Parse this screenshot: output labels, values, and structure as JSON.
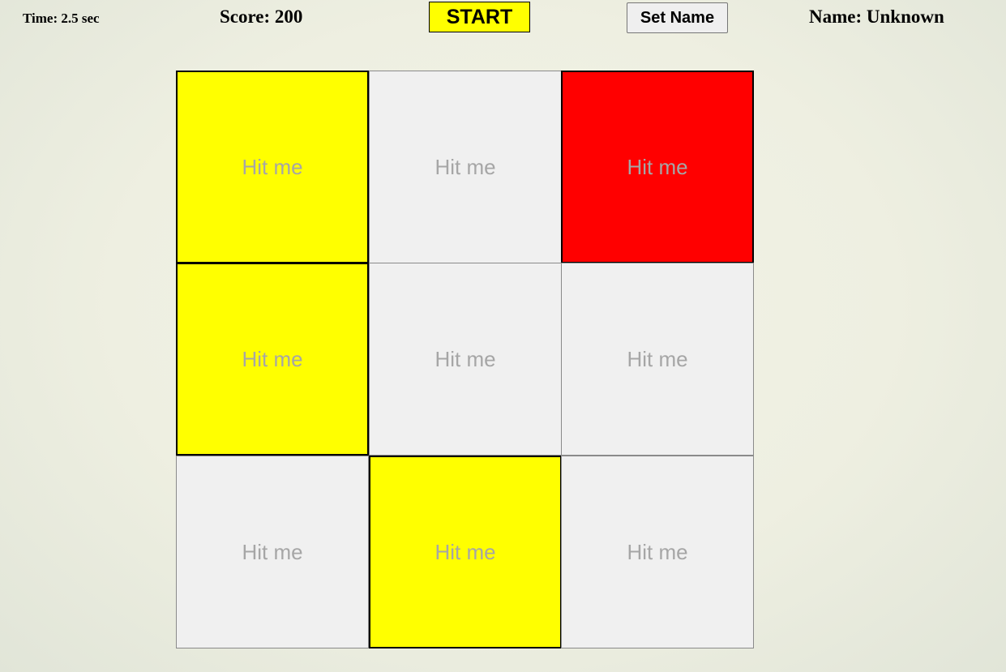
{
  "hud": {
    "time_label": "Time: 2.5 sec",
    "score_label": "Score: 200",
    "start_label": "START",
    "set_name_label": "Set Name",
    "name_label": "Name: Unknown"
  },
  "colors": {
    "inactive": "#f0f0f0",
    "yellow": "#ffff00",
    "red": "#ff0000",
    "start_button": "#ffff00"
  },
  "board": {
    "rows": 3,
    "cols": 3,
    "cells": [
      {
        "label": "Hit me",
        "state": "yellow"
      },
      {
        "label": "Hit me",
        "state": "inactive"
      },
      {
        "label": "Hit me",
        "state": "red"
      },
      {
        "label": "Hit me",
        "state": "yellow"
      },
      {
        "label": "Hit me",
        "state": "inactive"
      },
      {
        "label": "Hit me",
        "state": "inactive"
      },
      {
        "label": "Hit me",
        "state": "inactive"
      },
      {
        "label": "Hit me",
        "state": "yellow"
      },
      {
        "label": "Hit me",
        "state": "inactive"
      }
    ]
  }
}
